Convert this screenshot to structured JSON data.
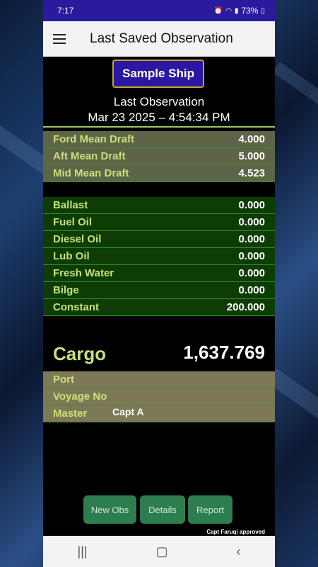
{
  "status_bar": {
    "time": "7:17",
    "icons": [
      "alarm-icon",
      "wifi-icon",
      "signal-icon"
    ],
    "battery": "73%"
  },
  "app_bar": {
    "title": "Last Saved Observation"
  },
  "ship": {
    "name": "Sample Ship"
  },
  "observation": {
    "label": "Last Observation",
    "datetime": "Mar 23 2025 – 4:54:34 PM"
  },
  "drafts": [
    {
      "label": "Ford Mean Draft",
      "value": "4.000"
    },
    {
      "label": "Aft Mean Draft",
      "value": "5.000"
    },
    {
      "label": "Mid Mean Draft",
      "value": "4.523"
    }
  ],
  "tanks": [
    {
      "label": "Ballast",
      "value": "0.000"
    },
    {
      "label": "Fuel Oil",
      "value": "0.000"
    },
    {
      "label": "Diesel Oil",
      "value": "0.000"
    },
    {
      "label": "Lub Oil",
      "value": "0.000"
    },
    {
      "label": "Fresh Water",
      "value": "0.000"
    },
    {
      "label": "Bilge",
      "value": "0.000"
    },
    {
      "label": "Constant",
      "value": "200.000"
    }
  ],
  "cargo": {
    "label": "Cargo",
    "value": "1,637.769"
  },
  "voyage_info": [
    {
      "label": "Port",
      "value": ""
    },
    {
      "label": "Voyage No",
      "value": ""
    },
    {
      "label": "Master",
      "value": "Capt A"
    }
  ],
  "buttons": {
    "new_obs": "New Obs",
    "details": "Details",
    "report": "Report"
  },
  "footer": {
    "approved": "Capt Faruqi approved"
  },
  "colors": {
    "status_bar": "#2a1a9e",
    "label_text": "#c9e07a",
    "action_button": "#2e7d4f",
    "ship_border": "#c9a227"
  }
}
